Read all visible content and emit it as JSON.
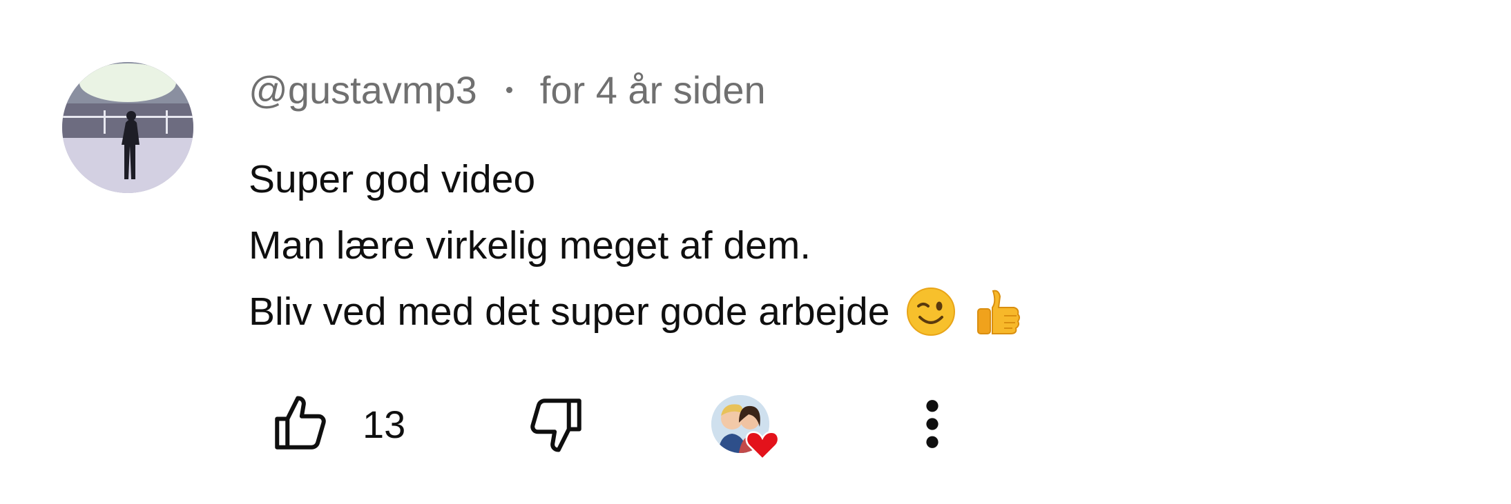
{
  "comment": {
    "author": "@gustavmp3",
    "timestamp": "for 4 år siden",
    "lines": [
      "Super god video",
      "Man lære virkelig meget af dem.",
      "Bliv ved med det super gode arbejde"
    ],
    "trailing_emojis": [
      "winking-face-icon",
      "thumbs-up-icon"
    ],
    "like_count": "13",
    "creator_heart": true
  },
  "colors": {
    "meta_text": "#707070",
    "body_text": "#0f0f0f",
    "heart": "#e3121b",
    "emoji_yellow": "#f7c02c"
  }
}
